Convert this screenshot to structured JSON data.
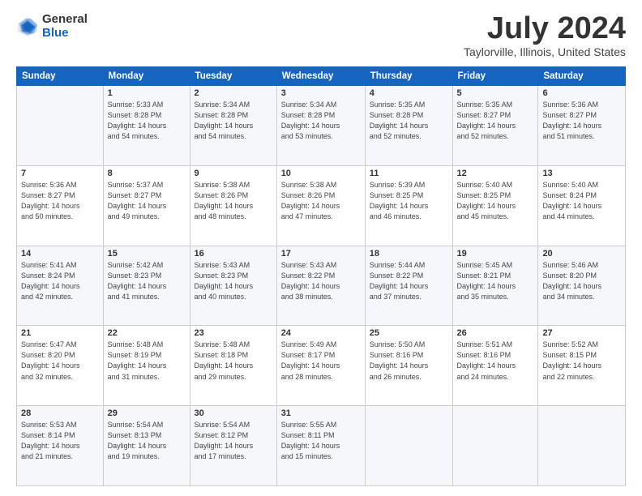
{
  "logo": {
    "general": "General",
    "blue": "Blue"
  },
  "header": {
    "month": "July 2024",
    "location": "Taylorville, Illinois, United States"
  },
  "weekdays": [
    "Sunday",
    "Monday",
    "Tuesday",
    "Wednesday",
    "Thursday",
    "Friday",
    "Saturday"
  ],
  "weeks": [
    [
      {
        "day": "",
        "info": ""
      },
      {
        "day": "1",
        "info": "Sunrise: 5:33 AM\nSunset: 8:28 PM\nDaylight: 14 hours\nand 54 minutes."
      },
      {
        "day": "2",
        "info": "Sunrise: 5:34 AM\nSunset: 8:28 PM\nDaylight: 14 hours\nand 54 minutes."
      },
      {
        "day": "3",
        "info": "Sunrise: 5:34 AM\nSunset: 8:28 PM\nDaylight: 14 hours\nand 53 minutes."
      },
      {
        "day": "4",
        "info": "Sunrise: 5:35 AM\nSunset: 8:28 PM\nDaylight: 14 hours\nand 52 minutes."
      },
      {
        "day": "5",
        "info": "Sunrise: 5:35 AM\nSunset: 8:27 PM\nDaylight: 14 hours\nand 52 minutes."
      },
      {
        "day": "6",
        "info": "Sunrise: 5:36 AM\nSunset: 8:27 PM\nDaylight: 14 hours\nand 51 minutes."
      }
    ],
    [
      {
        "day": "7",
        "info": "Sunrise: 5:36 AM\nSunset: 8:27 PM\nDaylight: 14 hours\nand 50 minutes."
      },
      {
        "day": "8",
        "info": "Sunrise: 5:37 AM\nSunset: 8:27 PM\nDaylight: 14 hours\nand 49 minutes."
      },
      {
        "day": "9",
        "info": "Sunrise: 5:38 AM\nSunset: 8:26 PM\nDaylight: 14 hours\nand 48 minutes."
      },
      {
        "day": "10",
        "info": "Sunrise: 5:38 AM\nSunset: 8:26 PM\nDaylight: 14 hours\nand 47 minutes."
      },
      {
        "day": "11",
        "info": "Sunrise: 5:39 AM\nSunset: 8:25 PM\nDaylight: 14 hours\nand 46 minutes."
      },
      {
        "day": "12",
        "info": "Sunrise: 5:40 AM\nSunset: 8:25 PM\nDaylight: 14 hours\nand 45 minutes."
      },
      {
        "day": "13",
        "info": "Sunrise: 5:40 AM\nSunset: 8:24 PM\nDaylight: 14 hours\nand 44 minutes."
      }
    ],
    [
      {
        "day": "14",
        "info": "Sunrise: 5:41 AM\nSunset: 8:24 PM\nDaylight: 14 hours\nand 42 minutes."
      },
      {
        "day": "15",
        "info": "Sunrise: 5:42 AM\nSunset: 8:23 PM\nDaylight: 14 hours\nand 41 minutes."
      },
      {
        "day": "16",
        "info": "Sunrise: 5:43 AM\nSunset: 8:23 PM\nDaylight: 14 hours\nand 40 minutes."
      },
      {
        "day": "17",
        "info": "Sunrise: 5:43 AM\nSunset: 8:22 PM\nDaylight: 14 hours\nand 38 minutes."
      },
      {
        "day": "18",
        "info": "Sunrise: 5:44 AM\nSunset: 8:22 PM\nDaylight: 14 hours\nand 37 minutes."
      },
      {
        "day": "19",
        "info": "Sunrise: 5:45 AM\nSunset: 8:21 PM\nDaylight: 14 hours\nand 35 minutes."
      },
      {
        "day": "20",
        "info": "Sunrise: 5:46 AM\nSunset: 8:20 PM\nDaylight: 14 hours\nand 34 minutes."
      }
    ],
    [
      {
        "day": "21",
        "info": "Sunrise: 5:47 AM\nSunset: 8:20 PM\nDaylight: 14 hours\nand 32 minutes."
      },
      {
        "day": "22",
        "info": "Sunrise: 5:48 AM\nSunset: 8:19 PM\nDaylight: 14 hours\nand 31 minutes."
      },
      {
        "day": "23",
        "info": "Sunrise: 5:48 AM\nSunset: 8:18 PM\nDaylight: 14 hours\nand 29 minutes."
      },
      {
        "day": "24",
        "info": "Sunrise: 5:49 AM\nSunset: 8:17 PM\nDaylight: 14 hours\nand 28 minutes."
      },
      {
        "day": "25",
        "info": "Sunrise: 5:50 AM\nSunset: 8:16 PM\nDaylight: 14 hours\nand 26 minutes."
      },
      {
        "day": "26",
        "info": "Sunrise: 5:51 AM\nSunset: 8:16 PM\nDaylight: 14 hours\nand 24 minutes."
      },
      {
        "day": "27",
        "info": "Sunrise: 5:52 AM\nSunset: 8:15 PM\nDaylight: 14 hours\nand 22 minutes."
      }
    ],
    [
      {
        "day": "28",
        "info": "Sunrise: 5:53 AM\nSunset: 8:14 PM\nDaylight: 14 hours\nand 21 minutes."
      },
      {
        "day": "29",
        "info": "Sunrise: 5:54 AM\nSunset: 8:13 PM\nDaylight: 14 hours\nand 19 minutes."
      },
      {
        "day": "30",
        "info": "Sunrise: 5:54 AM\nSunset: 8:12 PM\nDaylight: 14 hours\nand 17 minutes."
      },
      {
        "day": "31",
        "info": "Sunrise: 5:55 AM\nSunset: 8:11 PM\nDaylight: 14 hours\nand 15 minutes."
      },
      {
        "day": "",
        "info": ""
      },
      {
        "day": "",
        "info": ""
      },
      {
        "day": "",
        "info": ""
      }
    ]
  ]
}
